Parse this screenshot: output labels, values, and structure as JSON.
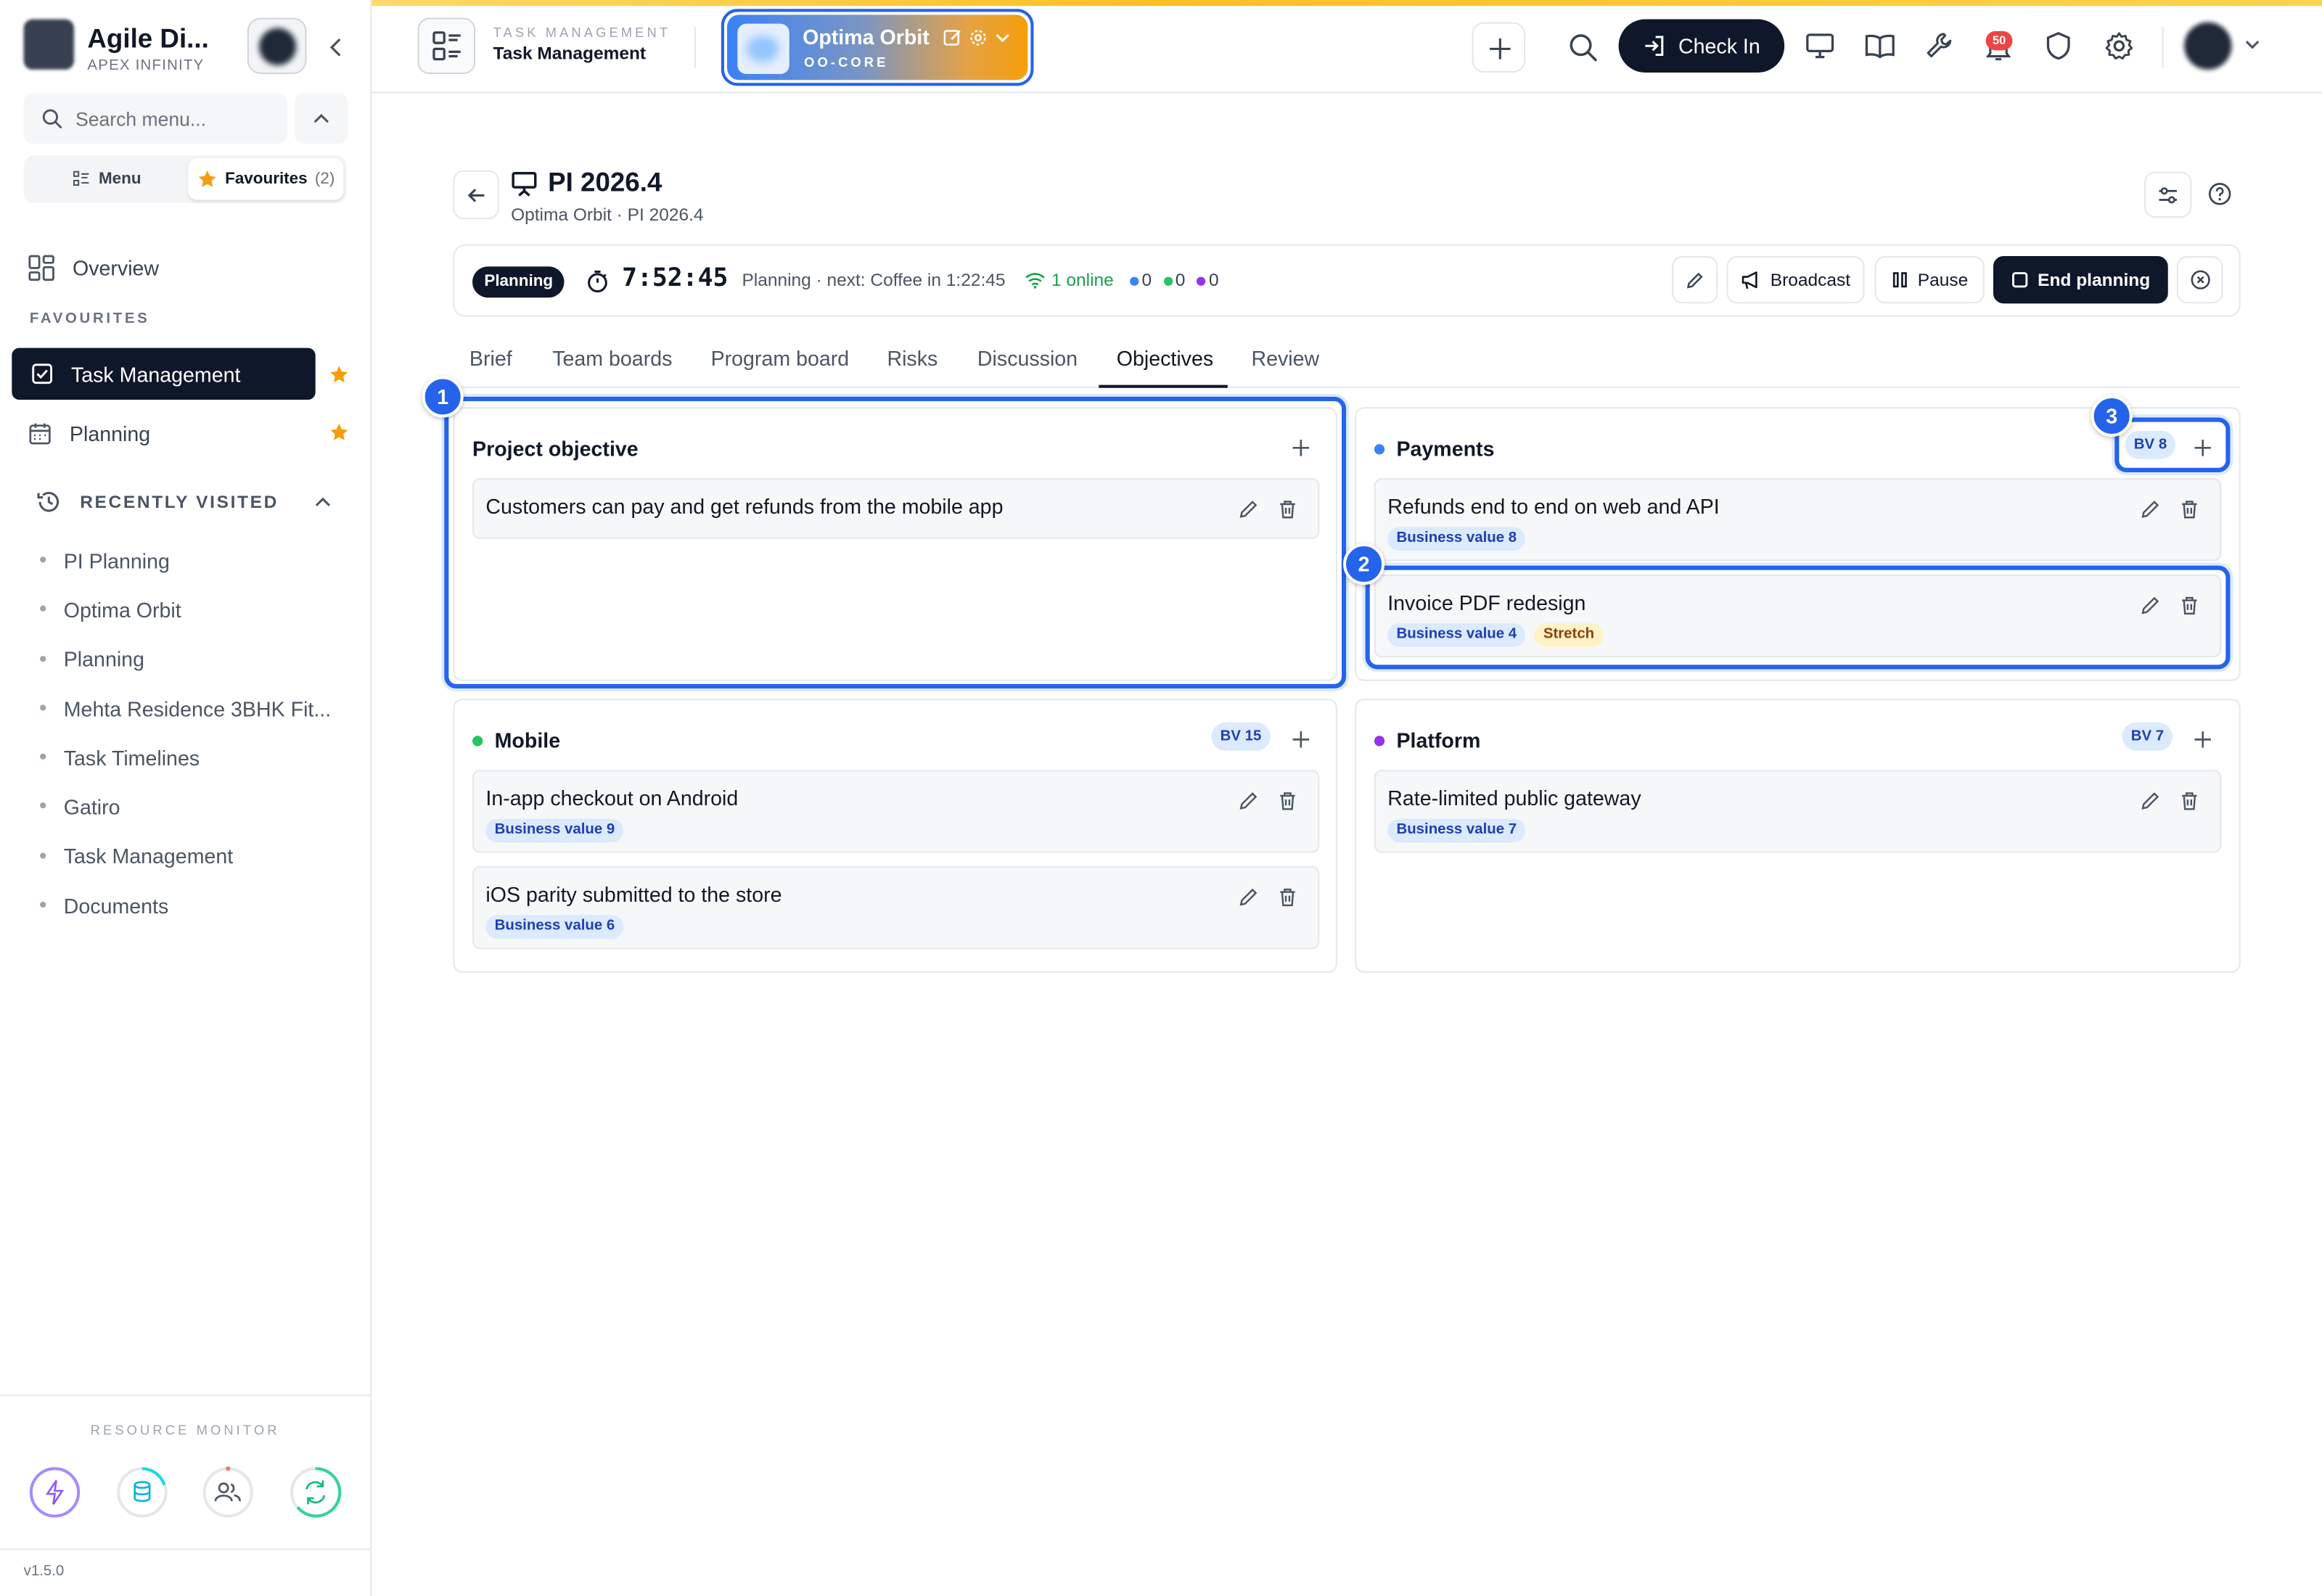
{
  "sidebar": {
    "brand_title": "Agile Di...",
    "brand_sub": "APEX INFINITY",
    "search_placeholder": "Search menu...",
    "seg_menu": "Menu",
    "seg_favourites": "Favourites",
    "seg_fav_count": "(2)",
    "overview": "Overview",
    "favourites_label": "FAVOURITES",
    "favourites": [
      "Task Management",
      "Planning"
    ],
    "recent_label": "RECENTLY VISITED",
    "recent": [
      "PI Planning",
      "Optima Orbit",
      "Planning",
      "Mehta Residence 3BHK Fit...",
      "Task Timelines",
      "Gatiro",
      "Task Management",
      "Documents"
    ],
    "resource_label": "RESOURCE MONITOR",
    "version": "v1.5.0"
  },
  "header": {
    "module_kicker": "TASK MANAGEMENT",
    "module_title": "Task Management",
    "project_name": "Optima Orbit",
    "project_code": "OO-CORE",
    "checkin_label": "Check In",
    "notification_count": "50"
  },
  "page": {
    "title": "PI 2026.4",
    "subtitle": "Optima Orbit · PI 2026.4",
    "phase": "Planning",
    "timer": "7:52:45",
    "next_text": "Planning · next: Coffee in 1:22:45",
    "online": "1 online",
    "counts": [
      "0",
      "0",
      "0"
    ],
    "count_colors": [
      "#3b82f6",
      "#22c55e",
      "#9333ea"
    ],
    "broadcast": "Broadcast",
    "pause": "Pause",
    "end_planning": "End planning"
  },
  "tabs": [
    "Brief",
    "Team boards",
    "Program board",
    "Risks",
    "Discussion",
    "Objectives",
    "Review"
  ],
  "active_tab": "Objectives",
  "objectives": {
    "project": {
      "title": "Project objective",
      "items": [
        {
          "text": "Customers can pay and get refunds from the mobile app"
        }
      ]
    },
    "teams": [
      {
        "name": "Payments",
        "color": "#3b82f6",
        "bv": "BV 8",
        "items": [
          {
            "text": "Refunds end to end on web and API",
            "tags": [
              "Business value 8"
            ]
          },
          {
            "text": "Invoice PDF redesign",
            "tags": [
              "Business value 4",
              "Stretch"
            ]
          }
        ]
      },
      {
        "name": "Mobile",
        "color": "#22c55e",
        "bv": "BV 15",
        "items": [
          {
            "text": "In-app checkout on Android",
            "tags": [
              "Business value 9"
            ]
          },
          {
            "text": "iOS parity submitted to the store",
            "tags": [
              "Business value 6"
            ]
          }
        ]
      },
      {
        "name": "Platform",
        "color": "#9333ea",
        "bv": "BV 7",
        "items": [
          {
            "text": "Rate-limited public gateway",
            "tags": [
              "Business value 7"
            ]
          }
        ]
      }
    ]
  },
  "step_markers": [
    "1",
    "2",
    "3"
  ]
}
